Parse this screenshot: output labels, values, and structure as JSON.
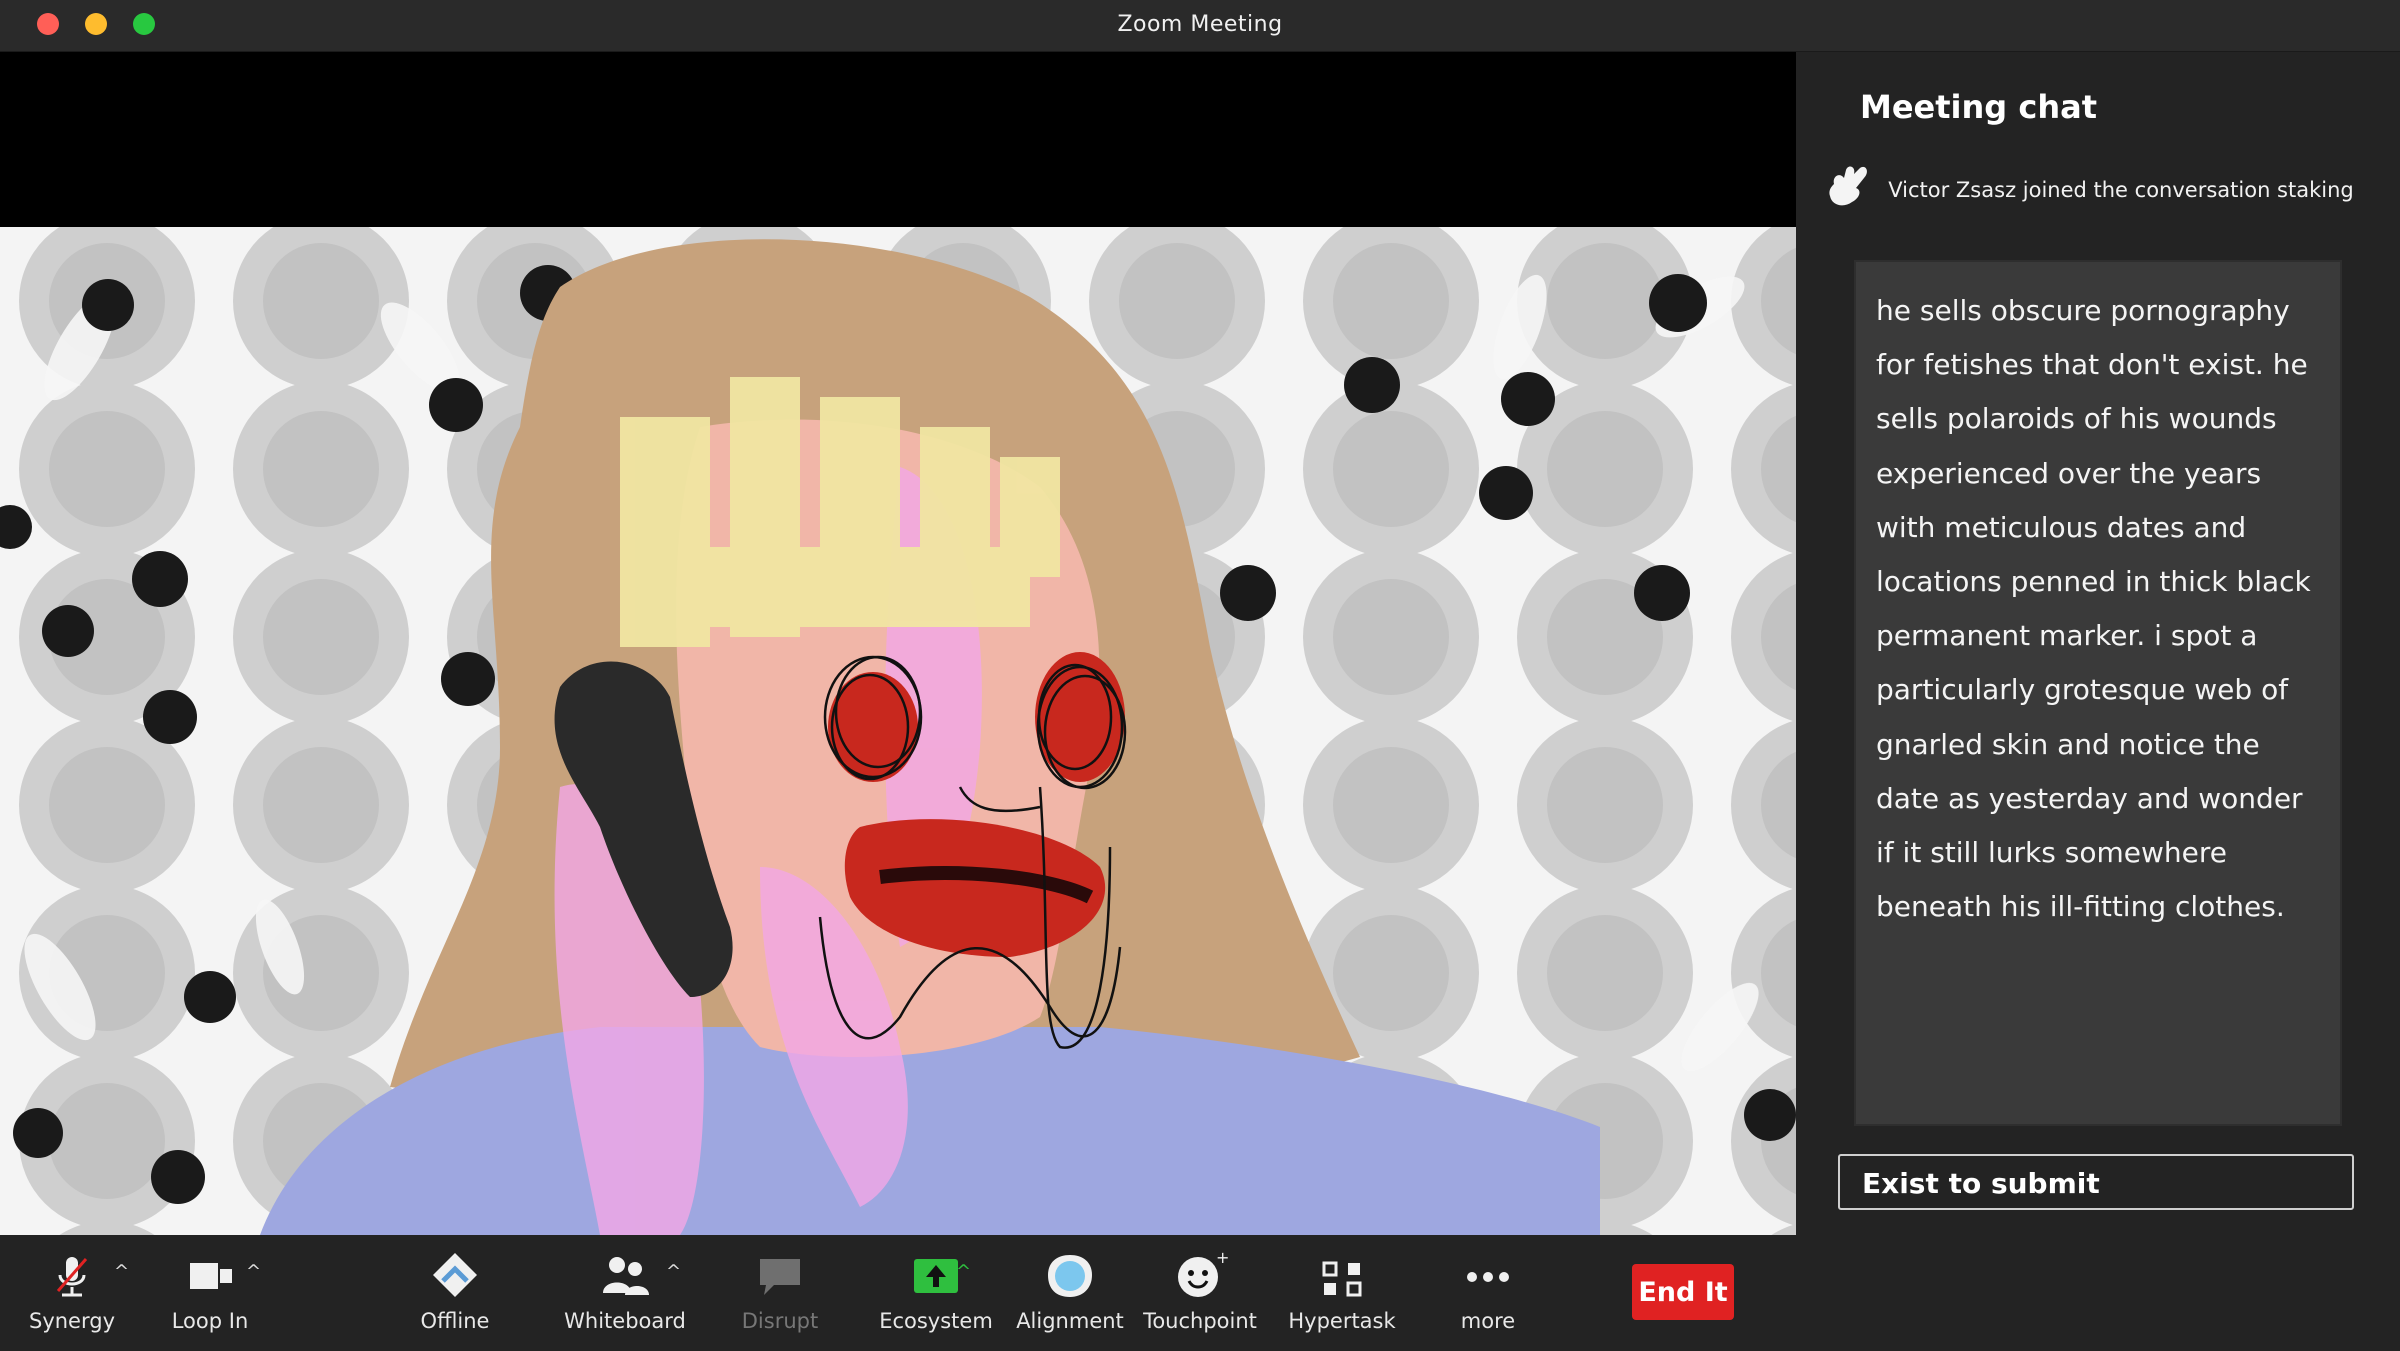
{
  "window": {
    "title": "Zoom Meeting"
  },
  "chat": {
    "title": "Meeting chat",
    "notice": "Victor Zsasz joined the conversation staking",
    "message": "he sells obscure pornography for fetishes that don't exist. he sells polaroids of his wounds experienced over the years with meticulous dates and locations penned in thick black permanent marker. i spot a particularly grotesque web of gnarled skin and notice the date as yesterday and wonder if it still lurks somewhere beneath his ill-fitting clothes.",
    "submit_label": "Exist to submit"
  },
  "toolbar": {
    "synergy": "Synergy",
    "loop_in": "Loop In",
    "offline": "Offline",
    "whiteboard": "Whiteboard",
    "disrupt": "Disrupt",
    "ecosystem": "Ecosystem",
    "alignment": "Alignment",
    "touchpoint": "Touchpoint",
    "hypertask": "Hypertask",
    "more": "more",
    "end": "End It"
  },
  "colors": {
    "end_button": "#e02222",
    "panel_bg": "#232323",
    "message_bg": "#3a3a3a",
    "ecosystem_icon": "#2fbf3f",
    "alignment_icon": "#7cc7ee"
  },
  "icons": {
    "synergy": "microphone-muted-icon",
    "loop_in": "video-camera-icon",
    "offline": "share-diamond-icon",
    "whiteboard": "participants-icon",
    "disrupt": "chat-bubble-icon",
    "ecosystem": "share-screen-up-arrow-icon",
    "alignment": "circle-record-icon",
    "touchpoint": "reactions-smiley-icon",
    "hypertask": "apps-icon",
    "more": "ellipsis-icon"
  }
}
